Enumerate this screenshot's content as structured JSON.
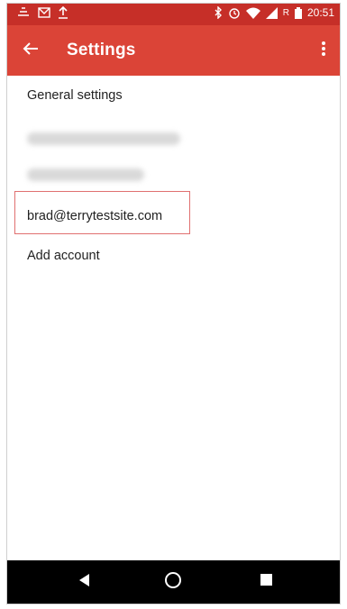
{
  "status_bar": {
    "time": "20:51",
    "roaming": "R"
  },
  "app_bar": {
    "title": "Settings"
  },
  "settings_list": {
    "general": "General settings",
    "account_3": "brad@terrytestsite.com",
    "add_account": "Add account"
  },
  "colors": {
    "status_bar": "#c62f28",
    "app_bar": "#db4437",
    "highlight_border": "#e07070",
    "nav_bar": "#000000"
  }
}
